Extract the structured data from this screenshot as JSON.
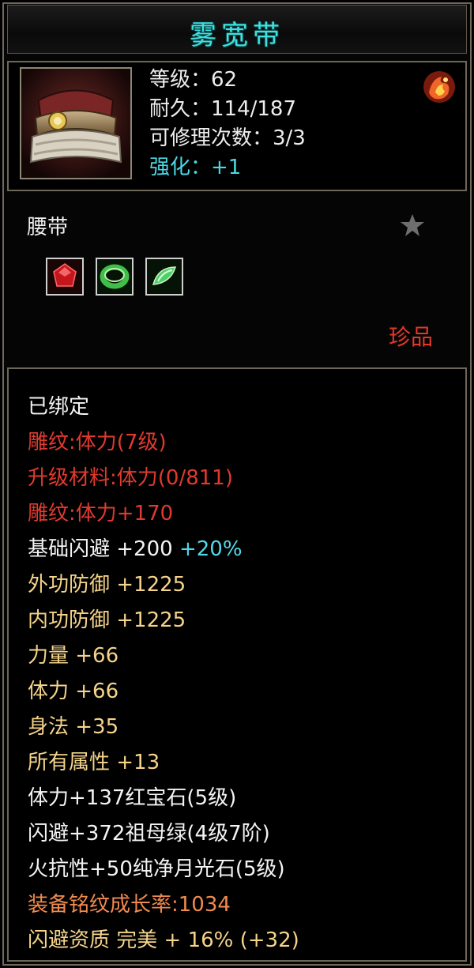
{
  "item": {
    "name": "雾宽带",
    "stats": {
      "level": "等级：62",
      "durability": "耐久：114/187",
      "repairs": "可修理次数：3/3",
      "enhance": "强化：+1"
    },
    "type": "腰带",
    "rarity": "珍品",
    "icons": {
      "item": "fur-belt-icon",
      "emblem": "fire-emblem-icon",
      "favorite": "star-icon",
      "gems": [
        "ruby-gem-icon",
        "emerald-gem-icon",
        "moonstone-gem-icon"
      ]
    }
  },
  "attributes": {
    "bound": "已绑定",
    "engrave_1": "雕纹:体力(7级)",
    "upgrade_material": "升级材料:体力(0/811)",
    "engrave_2": "雕纹:体力+170",
    "dodge_base_label": "基础闪避  +200",
    "dodge_base_bonus": "+20%",
    "outer_defense": "外功防御  +1225",
    "inner_defense": "内功防御  +1225",
    "strength": "力量  +66",
    "stamina": "体力  +66",
    "agility": "身法  +35",
    "all_attributes": "所有属性  +13",
    "gem_1": "体力+137红宝石(5级)",
    "gem_2": "闪避+372祖母绿(4级7阶)",
    "gem_3": "火抗性+50纯净月光石(5级)",
    "engrave_growth": "装备铭纹成长率:1034",
    "dodge_quality": "闪避资质  完美  + 16% (+32)"
  },
  "colors": {
    "title": "#3fe0df",
    "enhance": "#4ad8e3",
    "rarity": "#e2382a",
    "engrave": "#e03a2e",
    "bonus_stat": "#f5d48a",
    "growth": "#f08a4e",
    "border": "#6d6759"
  }
}
